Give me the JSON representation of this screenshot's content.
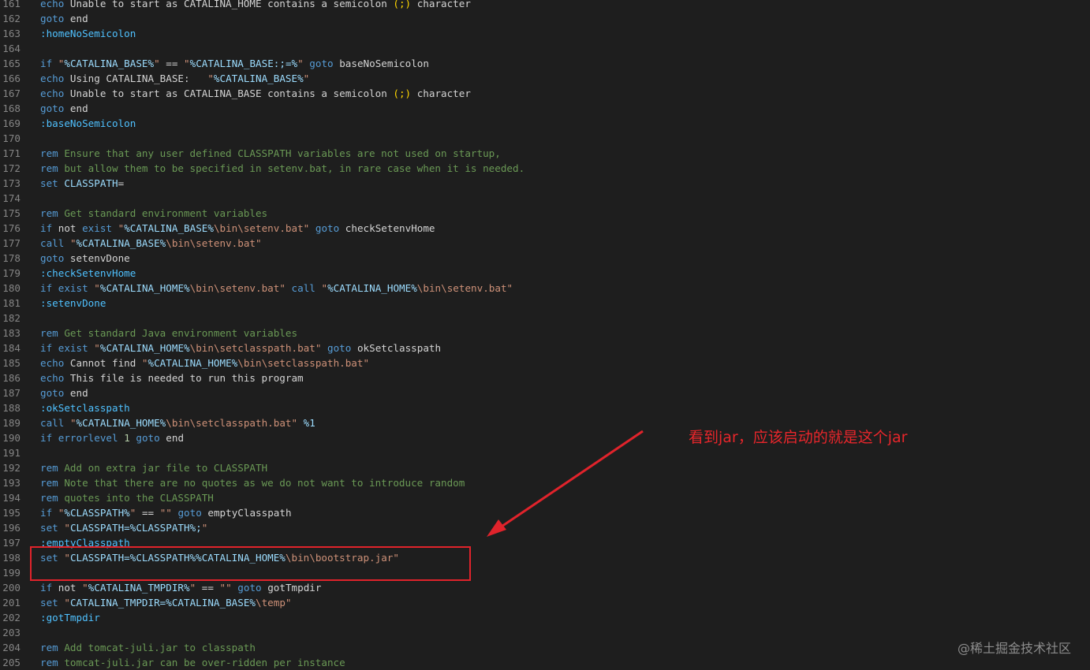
{
  "lines": [
    {
      "n": "161",
      "t": [
        [
          "k",
          "echo"
        ],
        [
          "t",
          " Unable to start as CATALINA_HOME contains a semicolon "
        ],
        [
          "p",
          "(;)"
        ],
        [
          "t",
          " character"
        ]
      ]
    },
    {
      "n": "162",
      "t": [
        [
          "k",
          "goto"
        ],
        [
          "t",
          " end"
        ]
      ]
    },
    {
      "n": "163",
      "t": [
        [
          "l",
          ":homeNoSemicolon"
        ]
      ]
    },
    {
      "n": "164",
      "t": []
    },
    {
      "n": "165",
      "t": [
        [
          "k",
          "if"
        ],
        [
          "t",
          " "
        ],
        [
          "s",
          "\""
        ],
        [
          "v",
          "%CATALINA_BASE%"
        ],
        [
          "s",
          "\""
        ],
        [
          "t",
          " == "
        ],
        [
          "s",
          "\""
        ],
        [
          "v",
          "%CATALINA_BASE:;=%"
        ],
        [
          "s",
          "\""
        ],
        [
          "t",
          " "
        ],
        [
          "k",
          "goto"
        ],
        [
          "t",
          " baseNoSemicolon"
        ]
      ]
    },
    {
      "n": "166",
      "t": [
        [
          "k",
          "echo"
        ],
        [
          "t",
          " Using CATALINA_BASE:   "
        ],
        [
          "s",
          "\""
        ],
        [
          "v",
          "%CATALINA_BASE%"
        ],
        [
          "s",
          "\""
        ]
      ]
    },
    {
      "n": "167",
      "t": [
        [
          "k",
          "echo"
        ],
        [
          "t",
          " Unable to start as CATALINA_BASE contains a semicolon "
        ],
        [
          "p",
          "(;)"
        ],
        [
          "t",
          " character"
        ]
      ]
    },
    {
      "n": "168",
      "t": [
        [
          "k",
          "goto"
        ],
        [
          "t",
          " end"
        ]
      ]
    },
    {
      "n": "169",
      "t": [
        [
          "l",
          ":baseNoSemicolon"
        ]
      ]
    },
    {
      "n": "170",
      "t": []
    },
    {
      "n": "171",
      "t": [
        [
          "k",
          "rem"
        ],
        [
          "c",
          " Ensure that any user defined CLASSPATH variables are not used on startup,"
        ]
      ]
    },
    {
      "n": "172",
      "t": [
        [
          "k",
          "rem"
        ],
        [
          "c",
          " but allow them to be specified in setenv.bat, in rare case when it is needed."
        ]
      ]
    },
    {
      "n": "173",
      "t": [
        [
          "k",
          "set"
        ],
        [
          "t",
          " "
        ],
        [
          "v",
          "CLASSPATH"
        ],
        [
          "t",
          "="
        ]
      ]
    },
    {
      "n": "174",
      "t": []
    },
    {
      "n": "175",
      "t": [
        [
          "k",
          "rem"
        ],
        [
          "c",
          " Get standard environment variables"
        ]
      ]
    },
    {
      "n": "176",
      "t": [
        [
          "k",
          "if"
        ],
        [
          "t",
          " not "
        ],
        [
          "k",
          "exist"
        ],
        [
          "t",
          " "
        ],
        [
          "s",
          "\""
        ],
        [
          "v",
          "%CATALINA_BASE%"
        ],
        [
          "s",
          "\\bin\\setenv.bat\""
        ],
        [
          "t",
          " "
        ],
        [
          "k",
          "goto"
        ],
        [
          "t",
          " checkSetenvHome"
        ]
      ]
    },
    {
      "n": "177",
      "t": [
        [
          "k",
          "call"
        ],
        [
          "t",
          " "
        ],
        [
          "s",
          "\""
        ],
        [
          "v",
          "%CATALINA_BASE%"
        ],
        [
          "s",
          "\\bin\\setenv.bat\""
        ]
      ]
    },
    {
      "n": "178",
      "t": [
        [
          "k",
          "goto"
        ],
        [
          "t",
          " setenvDone"
        ]
      ]
    },
    {
      "n": "179",
      "t": [
        [
          "l",
          ":checkSetenvHome"
        ]
      ]
    },
    {
      "n": "180",
      "t": [
        [
          "k",
          "if"
        ],
        [
          "t",
          " "
        ],
        [
          "k",
          "exist"
        ],
        [
          "t",
          " "
        ],
        [
          "s",
          "\""
        ],
        [
          "v",
          "%CATALINA_HOME%"
        ],
        [
          "s",
          "\\bin\\setenv.bat\""
        ],
        [
          "t",
          " "
        ],
        [
          "k",
          "call"
        ],
        [
          "t",
          " "
        ],
        [
          "s",
          "\""
        ],
        [
          "v",
          "%CATALINA_HOME%"
        ],
        [
          "s",
          "\\bin\\setenv.bat\""
        ]
      ]
    },
    {
      "n": "181",
      "t": [
        [
          "l",
          ":setenvDone"
        ]
      ]
    },
    {
      "n": "182",
      "t": []
    },
    {
      "n": "183",
      "t": [
        [
          "k",
          "rem"
        ],
        [
          "c",
          " Get standard Java environment variables"
        ]
      ]
    },
    {
      "n": "184",
      "t": [
        [
          "k",
          "if"
        ],
        [
          "t",
          " "
        ],
        [
          "k",
          "exist"
        ],
        [
          "t",
          " "
        ],
        [
          "s",
          "\""
        ],
        [
          "v",
          "%CATALINA_HOME%"
        ],
        [
          "s",
          "\\bin\\setclasspath.bat\""
        ],
        [
          "t",
          " "
        ],
        [
          "k",
          "goto"
        ],
        [
          "t",
          " okSetclasspath"
        ]
      ]
    },
    {
      "n": "185",
      "t": [
        [
          "k",
          "echo"
        ],
        [
          "t",
          " Cannot find "
        ],
        [
          "s",
          "\""
        ],
        [
          "v",
          "%CATALINA_HOME%"
        ],
        [
          "s",
          "\\bin\\setclasspath.bat\""
        ]
      ]
    },
    {
      "n": "186",
      "t": [
        [
          "k",
          "echo"
        ],
        [
          "t",
          " This file is needed to run this program"
        ]
      ]
    },
    {
      "n": "187",
      "t": [
        [
          "k",
          "goto"
        ],
        [
          "t",
          " end"
        ]
      ]
    },
    {
      "n": "188",
      "t": [
        [
          "l",
          ":okSetclasspath"
        ]
      ]
    },
    {
      "n": "189",
      "t": [
        [
          "k",
          "call"
        ],
        [
          "t",
          " "
        ],
        [
          "s",
          "\""
        ],
        [
          "v",
          "%CATALINA_HOME%"
        ],
        [
          "s",
          "\\bin\\setclasspath.bat\""
        ],
        [
          "t",
          " "
        ],
        [
          "v",
          "%1"
        ]
      ]
    },
    {
      "n": "190",
      "t": [
        [
          "k",
          "if"
        ],
        [
          "t",
          " "
        ],
        [
          "k",
          "errorlevel"
        ],
        [
          "t",
          " "
        ],
        [
          "n",
          "1"
        ],
        [
          "t",
          " "
        ],
        [
          "k",
          "goto"
        ],
        [
          "t",
          " end"
        ]
      ]
    },
    {
      "n": "191",
      "t": []
    },
    {
      "n": "192",
      "t": [
        [
          "k",
          "rem"
        ],
        [
          "c",
          " Add on extra jar file to CLASSPATH"
        ]
      ]
    },
    {
      "n": "193",
      "t": [
        [
          "k",
          "rem"
        ],
        [
          "c",
          " Note that there are no quotes as we do not want to introduce random"
        ]
      ]
    },
    {
      "n": "194",
      "t": [
        [
          "k",
          "rem"
        ],
        [
          "c",
          " quotes into the CLASSPATH"
        ]
      ]
    },
    {
      "n": "195",
      "t": [
        [
          "k",
          "if"
        ],
        [
          "t",
          " "
        ],
        [
          "s",
          "\""
        ],
        [
          "v",
          "%CLASSPATH%"
        ],
        [
          "s",
          "\""
        ],
        [
          "t",
          " == "
        ],
        [
          "s",
          "\"\""
        ],
        [
          "t",
          " "
        ],
        [
          "k",
          "goto"
        ],
        [
          "t",
          " emptyClasspath"
        ]
      ]
    },
    {
      "n": "196",
      "t": [
        [
          "k",
          "set"
        ],
        [
          "t",
          " "
        ],
        [
          "s",
          "\""
        ],
        [
          "v",
          "CLASSPATH=%CLASSPATH%;"
        ],
        [
          "s",
          "\""
        ]
      ]
    },
    {
      "n": "197",
      "t": [
        [
          "l",
          ":emptyClasspath"
        ]
      ]
    },
    {
      "n": "198",
      "t": [
        [
          "k",
          "set"
        ],
        [
          "t",
          " "
        ],
        [
          "s",
          "\""
        ],
        [
          "v",
          "CLASSPATH=%CLASSPATH%%CATALINA_HOME%"
        ],
        [
          "s",
          "\\bin\\bootstrap.jar\""
        ]
      ]
    },
    {
      "n": "199",
      "t": []
    },
    {
      "n": "200",
      "t": [
        [
          "k",
          "if"
        ],
        [
          "t",
          " not "
        ],
        [
          "s",
          "\""
        ],
        [
          "v",
          "%CATALINA_TMPDIR%"
        ],
        [
          "s",
          "\""
        ],
        [
          "t",
          " == "
        ],
        [
          "s",
          "\"\""
        ],
        [
          "t",
          " "
        ],
        [
          "k",
          "goto"
        ],
        [
          "t",
          " gotTmpdir"
        ]
      ]
    },
    {
      "n": "201",
      "t": [
        [
          "k",
          "set"
        ],
        [
          "t",
          " "
        ],
        [
          "s",
          "\""
        ],
        [
          "v",
          "CATALINA_TMPDIR=%CATALINA_BASE%"
        ],
        [
          "s",
          "\\temp\""
        ]
      ]
    },
    {
      "n": "202",
      "t": [
        [
          "l",
          ":gotTmpdir"
        ]
      ]
    },
    {
      "n": "203",
      "t": []
    },
    {
      "n": "204",
      "t": [
        [
          "k",
          "rem"
        ],
        [
          "c",
          " Add tomcat-juli.jar to classpath"
        ]
      ]
    },
    {
      "n": "205",
      "t": [
        [
          "k",
          "rem"
        ],
        [
          "c",
          " tomcat-juli.jar can be over-ridden per instance"
        ]
      ]
    }
  ],
  "annotation": {
    "text": "看到jar，应该启动的就是这个jar",
    "color": "#e8262b"
  },
  "watermark": "@稀土掘金技术社区",
  "colors": {
    "background": "#1e1e1e",
    "keyword": "#569cd6",
    "string": "#ce9178",
    "variable": "#9cdcfe",
    "comment": "#6a9955",
    "label": "#4fc1ff",
    "number": "#b5cea8",
    "annotation_red": "#e0232b"
  }
}
